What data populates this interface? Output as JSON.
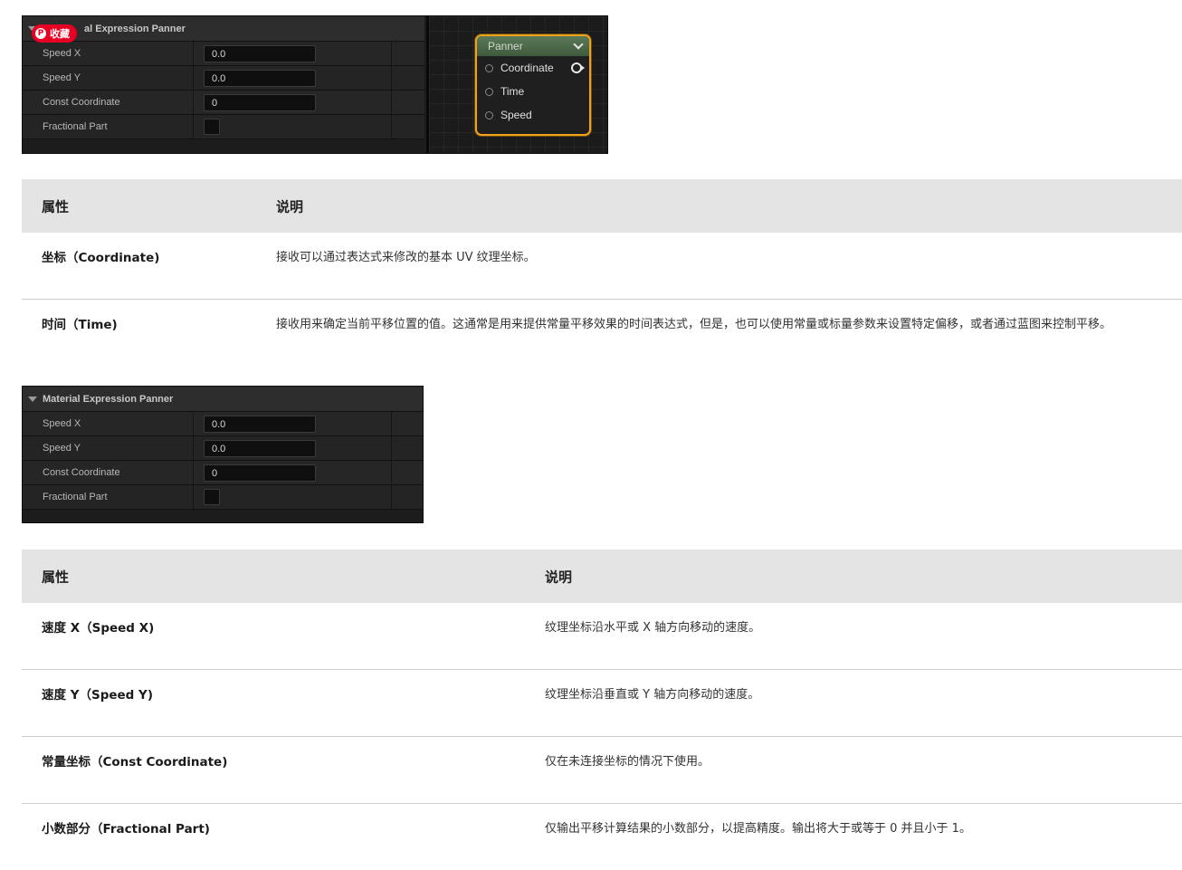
{
  "panel1": {
    "title": "Material Expression Panner",
    "title_visible": "al Expression Panner",
    "badge": "收藏",
    "rows": [
      {
        "label": "Speed X",
        "value": "0.0",
        "kind": "input"
      },
      {
        "label": "Speed Y",
        "value": "0.0",
        "kind": "input"
      },
      {
        "label": "Const Coordinate",
        "value": "0",
        "kind": "input"
      },
      {
        "label": "Fractional Part",
        "value": "",
        "kind": "checkbox"
      }
    ]
  },
  "node": {
    "title": "Panner",
    "pins": [
      "Coordinate",
      "Time",
      "Speed"
    ]
  },
  "table1": {
    "headers": [
      "属性",
      "说明"
    ],
    "rows": [
      {
        "name": "坐标（Coordinate)",
        "desc": "接收可以通过表达式来修改的基本 UV 纹理坐标。"
      },
      {
        "name": "时间（Time)",
        "desc": "接收用来确定当前平移位置的值。这通常是用来提供常量平移效果的时间表达式，但是，也可以使用常量或标量参数来设置特定偏移，或者通过蓝图来控制平移。"
      }
    ]
  },
  "panel2": {
    "title": "Material Expression Panner",
    "rows": [
      {
        "label": "Speed X",
        "value": "0.0",
        "kind": "input"
      },
      {
        "label": "Speed Y",
        "value": "0.0",
        "kind": "input"
      },
      {
        "label": "Const Coordinate",
        "value": "0",
        "kind": "input"
      },
      {
        "label": "Fractional Part",
        "value": "",
        "kind": "checkbox"
      }
    ]
  },
  "table2": {
    "headers": [
      "属性",
      "说明"
    ],
    "rows": [
      {
        "name": "速度 X（Speed X)",
        "desc": "纹理坐标沿水平或 X 轴方向移动的速度。"
      },
      {
        "name": "速度 Y（Speed Y)",
        "desc": "纹理坐标沿垂直或 Y 轴方向移动的速度。"
      },
      {
        "name": "常量坐标（Const Coordinate)",
        "desc": "仅在未连接坐标的情况下使用。"
      },
      {
        "name": "小数部分（Fractional Part)",
        "desc": "仅输出平移计算结果的小数部分，以提高精度。输出将大于或等于 0 并且小于 1。"
      }
    ]
  }
}
